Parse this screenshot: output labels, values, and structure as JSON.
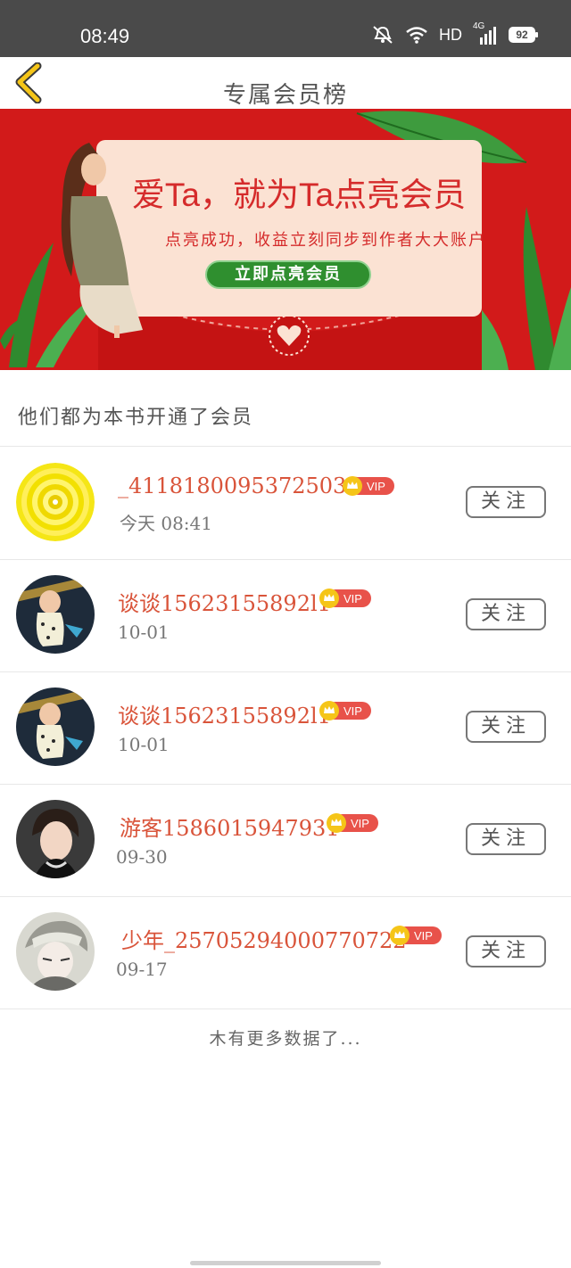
{
  "status_bar": {
    "time": "08:49",
    "network": "HD",
    "signal": "4G",
    "battery": "92"
  },
  "header": {
    "title": "专属会员榜"
  },
  "banner": {
    "title": "爱Ta，就为Ta点亮会员",
    "subtitle": "点亮成功，收益立刻同步到作者大大账户",
    "button": "立即点亮会员"
  },
  "section_title": "他们都为本书开通了会员",
  "members": [
    {
      "name": "_4118180095372503O",
      "date": "今天  08:41",
      "badge": "VIP",
      "follow": "关注",
      "avatar": "flower"
    },
    {
      "name": "谈谈15623155892l1",
      "date": "10-01",
      "badge": "VIP",
      "follow": "关注",
      "avatar": "baby"
    },
    {
      "name": "谈谈15623155892l1",
      "date": "10-01",
      "badge": "VIP",
      "follow": "关注",
      "avatar": "baby"
    },
    {
      "name": "游客1586015947931",
      "date": "09-30",
      "badge": "VIP",
      "follow": "关注",
      "avatar": "person"
    },
    {
      "name": "少年_25705294000770722",
      "date": "09-17",
      "badge": "VIP",
      "follow": "关注",
      "avatar": "anime"
    }
  ],
  "footer_text": "木有更多数据了...",
  "colors": {
    "accent": "#d9543a",
    "banner_red": "#d21a1a",
    "vip_red": "#e8524a",
    "vip_gold": "#f5c518"
  }
}
